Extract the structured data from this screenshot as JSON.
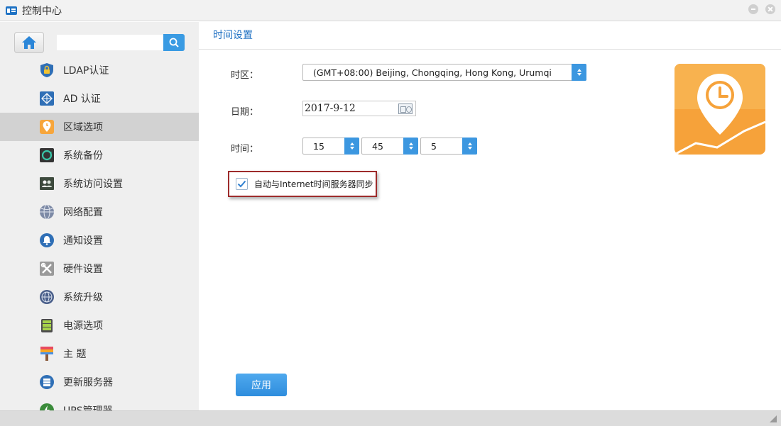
{
  "window": {
    "title": "控制中心",
    "app_icon": "control-panel-icon",
    "buttons": [
      "minimize-icon",
      "close-icon"
    ]
  },
  "sidebar": {
    "home_icon": "home-icon",
    "search": {
      "value": "",
      "placeholder": "",
      "icon": "search-icon"
    },
    "items": [
      {
        "label": "LDAP认证",
        "icon": "ldap-lock-icon",
        "active": false
      },
      {
        "label": "AD 认证",
        "icon": "ad-network-icon",
        "active": false
      },
      {
        "label": "区域选项",
        "icon": "region-clock-icon",
        "active": true
      },
      {
        "label": "系统备份",
        "icon": "backup-icon",
        "active": false
      },
      {
        "label": "系统访问设置",
        "icon": "users-access-icon",
        "active": false
      },
      {
        "label": "网络配置",
        "icon": "globe-network-icon",
        "active": false
      },
      {
        "label": "通知设置",
        "icon": "bell-icon",
        "active": false
      },
      {
        "label": "硬件设置",
        "icon": "tools-icon",
        "active": false
      },
      {
        "label": "系统升级",
        "icon": "upgrade-globe-icon",
        "active": false
      },
      {
        "label": "电源选项",
        "icon": "power-battery-icon",
        "active": false
      },
      {
        "label": "主 题",
        "icon": "theme-brush-icon",
        "active": false
      },
      {
        "label": "更新服务器",
        "icon": "update-server-icon",
        "active": false
      },
      {
        "label": "UPS管理器",
        "icon": "ups-icon",
        "active": false
      }
    ]
  },
  "main": {
    "title": "时间设置",
    "timezone": {
      "label": "时区：",
      "value": "(GMT+08:00) Beijing, Chongqing, Hong Kong, Urumqi"
    },
    "date": {
      "label": "日期：",
      "value": "2017-9-12",
      "icon": "calendar-icon"
    },
    "time": {
      "label": "时间：",
      "hour": "15",
      "minute": "45",
      "second": "5"
    },
    "sync": {
      "label": "自动与Internet时间服务器同步",
      "checked": true
    },
    "apply_label": "应用",
    "illustration": "region-map-pin-clock-icon"
  },
  "colors": {
    "accent": "#3a9be3",
    "title_blue": "#1d6fc2",
    "active_item": "#d2d2d2",
    "sidebar_bg": "#efefef",
    "highlight_border": "#9d2b2b",
    "orange": "#f7a63c"
  }
}
